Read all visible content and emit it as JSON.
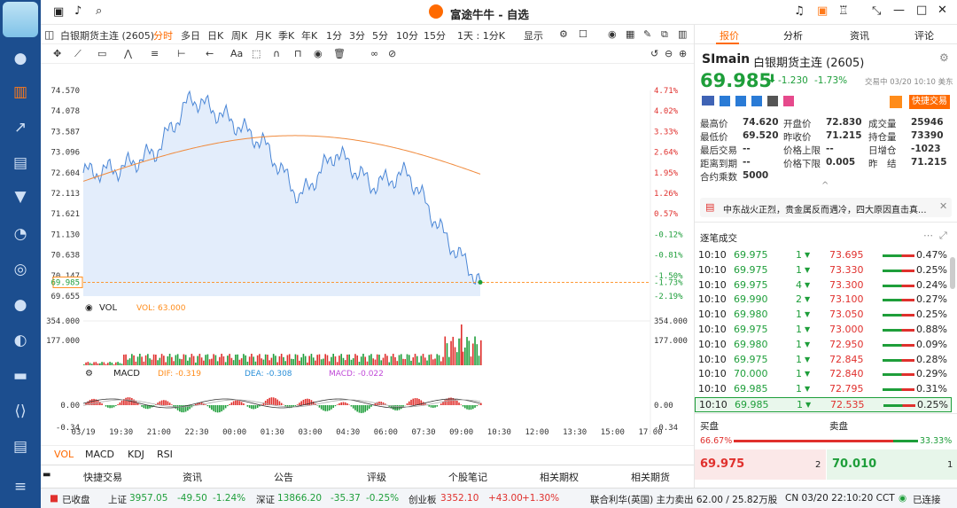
{
  "window": {
    "title": "富途牛牛 - 自选",
    "right_icons": [
      "headset-icon",
      "bag-icon",
      "shirt-icon",
      "collapse-icon",
      "maximize-icon",
      "close-icon"
    ]
  },
  "toolbar": {
    "tab_name": "白银期货主连 (2605)",
    "periods": [
      "分时",
      "多日",
      "日K",
      "周K",
      "月K",
      "季K",
      "年K",
      "1分",
      "3分",
      "5分",
      "10分",
      "15分"
    ],
    "period_selected": "分时",
    "range_select": "1天 : 1分K",
    "display_select": "显示"
  },
  "chart": {
    "y_left": [
      "74.570",
      "74.078",
      "73.587",
      "73.096",
      "72.604",
      "72.113",
      "71.621",
      "71.130",
      "70.638",
      "70.147",
      "69.655"
    ],
    "y_right": [
      "4.71%",
      "4.02%",
      "3.33%",
      "2.64%",
      "1.95%",
      "1.26%",
      "0.57%",
      "-0.12%",
      "-0.81%",
      "-1.50%",
      "-2.19%"
    ],
    "current_price": "69.985",
    "current_pct": "-1.73%",
    "vol_label": "VOL",
    "vol_value_label": "VOL: 63.000",
    "vol_ticks": [
      "354.000",
      "177.000"
    ],
    "macd_label": "MACD",
    "macd_dif": "DIF: -0.319",
    "macd_dea": "DEA: -0.308",
    "macd_macd": "MACD: -0.022",
    "macd_ticks": [
      "0.00",
      "-0.34"
    ],
    "x_ticks": [
      "03/19",
      "19:30",
      "21:00",
      "22:30",
      "00:00",
      "01:30",
      "03:00",
      "04:30",
      "06:00",
      "07:30",
      "09:00",
      "10:30",
      "12:00",
      "13:30",
      "15:00",
      "17:00"
    ]
  },
  "chart_data": {
    "type": "line",
    "title": "",
    "x": [
      "03/19 18:00",
      "19:30",
      "21:00",
      "22:30",
      "00:00",
      "01:30",
      "03:00",
      "04:30",
      "06:00",
      "07:30",
      "09:00",
      "10:10"
    ],
    "series": [
      {
        "name": "",
        "values": [
          72.6,
          72.7,
          73.1,
          74.4,
          73.9,
          73.3,
          72.0,
          73.1,
          72.3,
          72.6,
          71.1,
          69.985
        ]
      }
    ],
    "ylim": [
      69.655,
      74.57
    ]
  },
  "bottom_tabs": [
    "VOL",
    "MACD",
    "KDJ",
    "RSI"
  ],
  "bottom_links": [
    "快捷交易",
    "资讯",
    "公告",
    "评级",
    "个股笔记",
    "相关期权",
    "相关期货"
  ],
  "right": {
    "tabs": [
      "报价",
      "分析",
      "资讯",
      "评论"
    ],
    "symbol": "SImain",
    "name": "白银期货主连 (2605)",
    "price": "69.985",
    "change": "-1.230",
    "change_pct": "-1.73%",
    "time_note": "交易中 03/20 10:10 美东",
    "quick_trade": "快捷交易",
    "stats": [
      [
        "最高价",
        "74.620"
      ],
      [
        "开盘价",
        "72.830"
      ],
      [
        "成交量",
        "25946"
      ],
      [
        "最低价",
        "69.520"
      ],
      [
        "昨收价",
        "71.215"
      ],
      [
        "持仓量",
        "73390"
      ],
      [
        "最后交易",
        "--"
      ],
      [
        "价格上限",
        "--"
      ],
      [
        "日增仓",
        "-1023"
      ],
      [
        "距离到期",
        "--"
      ],
      [
        "价格下限",
        "0.005"
      ],
      [
        "昨　结",
        "71.215"
      ],
      [
        "合约乘数",
        "5000"
      ]
    ],
    "news": "中东战火正烈，贵金属反而遇冷，四大原因直击真...",
    "ticks_title": "逐笔成交",
    "ticks": [
      [
        "10:10",
        "69.975",
        "1",
        "73.695",
        "0.47%"
      ],
      [
        "10:10",
        "69.975",
        "1",
        "73.330",
        "0.25%"
      ],
      [
        "10:10",
        "69.975",
        "4",
        "73.300",
        "0.24%"
      ],
      [
        "10:10",
        "69.990",
        "2",
        "73.100",
        "0.27%"
      ],
      [
        "10:10",
        "69.980",
        "1",
        "73.050",
        "0.25%"
      ],
      [
        "10:10",
        "69.975",
        "1",
        "73.000",
        "0.88%"
      ],
      [
        "10:10",
        "69.980",
        "1",
        "72.950",
        "0.09%"
      ],
      [
        "10:10",
        "69.975",
        "1",
        "72.845",
        "0.28%"
      ],
      [
        "10:10",
        "70.000",
        "1",
        "72.840",
        "0.29%"
      ],
      [
        "10:10",
        "69.985",
        "1",
        "72.795",
        "0.31%"
      ],
      [
        "10:10",
        "69.985",
        "1",
        "72.535",
        "0.25%"
      ]
    ],
    "buy_label": "买盘",
    "sell_label": "卖盘",
    "buy_pct": "66.67%",
    "sell_pct": "33.33%",
    "bid": "69.975",
    "bid_size": "2",
    "ask": "70.010",
    "ask_size": "1"
  },
  "status": {
    "closed": "已收盘",
    "sh_label": "上证",
    "sh_val": "3957.05",
    "sh_chg": "-49.50",
    "sh_pct": "-1.24%",
    "sz_label": "深证",
    "sz_val": "13866.20",
    "sz_chg": "-35.37",
    "sz_pct": "-0.25%",
    "cy_label": "创业板",
    "cy_val": "3352.10",
    "cy_chg": "+43.00",
    "cy_pct": "+1.30%",
    "fund": "联合利华(英国) 主力卖出 62.00 / 25.82万股",
    "clock": "CN 03/20 22:10:20 CCT",
    "conn": "已连接"
  }
}
